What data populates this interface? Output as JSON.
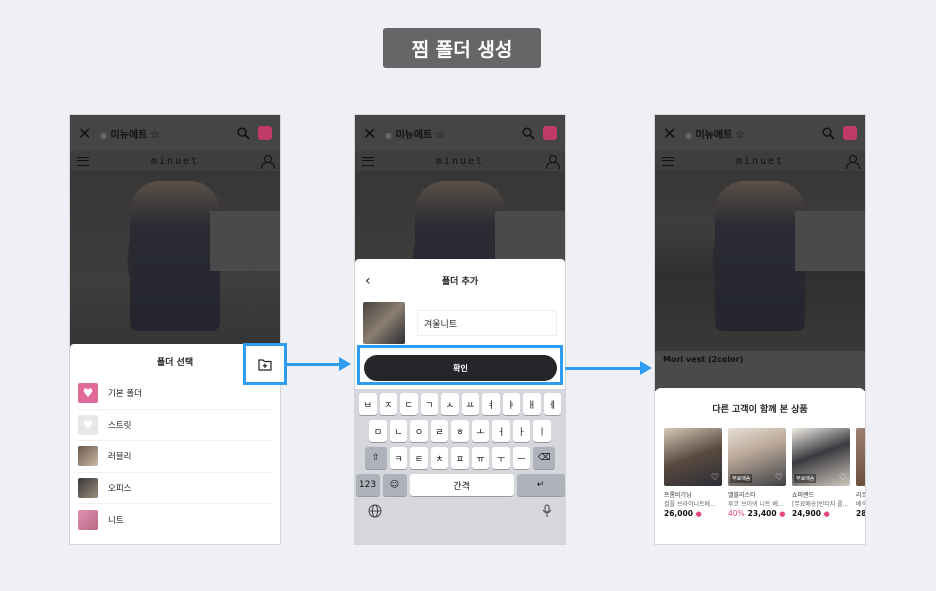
{
  "header": {
    "title": "찜 폴더 생성"
  },
  "app": {
    "site_name": "미뉴에트",
    "brand": "minuet"
  },
  "step1": {
    "sheet_title": "폴더 선택",
    "folders": [
      {
        "label": "기본 폴더"
      },
      {
        "label": "스트릿"
      },
      {
        "label": "러블리"
      },
      {
        "label": "오피스"
      },
      {
        "label": "니트"
      }
    ]
  },
  "step2": {
    "sheet_title": "폴더 추가",
    "folder_name_value": "겨울니트",
    "confirm_label": "확인",
    "keyboard": {
      "row1": [
        "ㅂ",
        "ㅈ",
        "ㄷ",
        "ㄱ",
        "ㅅ",
        "ㅛ",
        "ㅕ",
        "ㅑ",
        "ㅐ",
        "ㅔ"
      ],
      "row2": [
        "ㅁ",
        "ㄴ",
        "ㅇ",
        "ㄹ",
        "ㅎ",
        "ㅗ",
        "ㅓ",
        "ㅏ",
        "ㅣ"
      ],
      "row3": [
        "ㅋ",
        "ㅌ",
        "ㅊ",
        "ㅍ",
        "ㅠ",
        "ㅜ",
        "ㅡ"
      ],
      "numbers_label": "123",
      "space_label": "간격"
    }
  },
  "step3": {
    "product_name": "Mori vest (2color)",
    "sheet_title": "다른 고객이 함께 본 상품",
    "products": [
      {
        "shop": "프롬비기닝",
        "desc": "컬플 브라이니트베…",
        "price": "26,000",
        "discount": "",
        "badge": ""
      },
      {
        "shop": "앨블리스타",
        "desc": "루코 브이넥 니트 베…",
        "price": "23,400",
        "discount": "40%",
        "badge": "무료배송"
      },
      {
        "shop": "쇼퍼랜드",
        "desc": "[무료배송]빈티지 플…",
        "price": "24,900",
        "discount": "",
        "badge": "무료배송"
      },
      {
        "shop": "리코",
        "desc": "베색…",
        "price": "28,",
        "discount": "",
        "badge": ""
      }
    ]
  },
  "colors": {
    "highlight": "#2f9bf1",
    "accent_pink": "#e3467d"
  }
}
